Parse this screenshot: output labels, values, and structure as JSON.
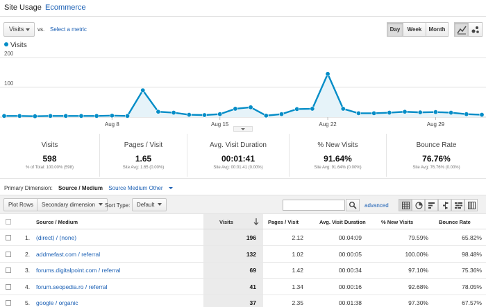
{
  "tabs": [
    {
      "label": "Site Usage"
    },
    {
      "label": "Ecommerce"
    }
  ],
  "metric_controls": {
    "metric_select": "Visits",
    "vs_label": "vs.",
    "select_metric_link": "Select a metric",
    "periods": [
      "Day",
      "Week",
      "Month"
    ],
    "active_period": "Day"
  },
  "legend": {
    "label": "Visits",
    "color": "#058dc7"
  },
  "chart_data": {
    "type": "area",
    "series": [
      {
        "name": "Visits",
        "values": [
          4,
          4,
          3,
          4,
          4,
          4,
          4,
          5,
          4,
          90,
          18,
          15,
          8,
          7,
          10,
          28,
          33,
          5,
          10,
          27,
          28,
          145,
          28,
          13,
          13,
          15,
          18,
          16,
          17,
          15,
          10,
          8
        ]
      }
    ],
    "ylim": [
      0,
      200
    ],
    "yticks": [
      "200",
      "100"
    ],
    "xticks": [
      "Aug 8",
      "Aug 15",
      "Aug 22",
      "Aug 29"
    ],
    "xtick_indices": [
      7,
      14,
      21,
      28
    ],
    "color": "#058dc7",
    "fill": "#e6f3f9",
    "grid": true
  },
  "scorecards": [
    {
      "label": "Visits",
      "value": "598",
      "sub": "% of Total: 100.00% (598)"
    },
    {
      "label": "Pages / Visit",
      "value": "1.65",
      "sub": "Site Avg: 1.65 (0.00%)"
    },
    {
      "label": "Avg. Visit Duration",
      "value": "00:01:41",
      "sub": "Site Avg: 00:01:41 (0.00%)"
    },
    {
      "label": "% New Visits",
      "value": "91.64%",
      "sub": "Site Avg: 91.64% (0.00%)"
    },
    {
      "label": "Bounce Rate",
      "value": "76.76%",
      "sub": "Site Avg: 76.76% (0.00%)"
    }
  ],
  "primary_dimension": {
    "label": "Primary Dimension:",
    "selected": "Source / Medium",
    "options": [
      "Source",
      "Medium"
    ],
    "other": "Other"
  },
  "toolbar": {
    "plot_rows": "Plot Rows",
    "secondary_dimension": "Secondary dimension",
    "sort_type_label": "Sort Type:",
    "sort_type_value": "Default",
    "search_value": "",
    "advanced": "advanced"
  },
  "table": {
    "headers": {
      "source_medium": "Source / Medium",
      "visits": "Visits",
      "pages_visit": "Pages / Visit",
      "avg_duration": "Avg. Visit Duration",
      "new_visits": "% New Visits",
      "bounce_rate": "Bounce Rate"
    },
    "rows": [
      {
        "idx": "1.",
        "source": "(direct) / (none)",
        "visits": "196",
        "pages": "2.12",
        "duration": "00:04:09",
        "new": "79.59%",
        "bounce": "65.82%"
      },
      {
        "idx": "2.",
        "source": "addmefast.com / referral",
        "visits": "132",
        "pages": "1.02",
        "duration": "00:00:05",
        "new": "100.00%",
        "bounce": "98.48%"
      },
      {
        "idx": "3.",
        "source": "forums.digitalpoint.com / referral",
        "visits": "69",
        "pages": "1.42",
        "duration": "00:00:34",
        "new": "97.10%",
        "bounce": "75.36%"
      },
      {
        "idx": "4.",
        "source": "forum.seopedia.ro / referral",
        "visits": "41",
        "pages": "1.34",
        "duration": "00:00:16",
        "new": "92.68%",
        "bounce": "78.05%"
      },
      {
        "idx": "5.",
        "source": "google / organic",
        "visits": "37",
        "pages": "2.35",
        "duration": "00:01:38",
        "new": "97.30%",
        "bounce": "67.57%"
      }
    ]
  }
}
